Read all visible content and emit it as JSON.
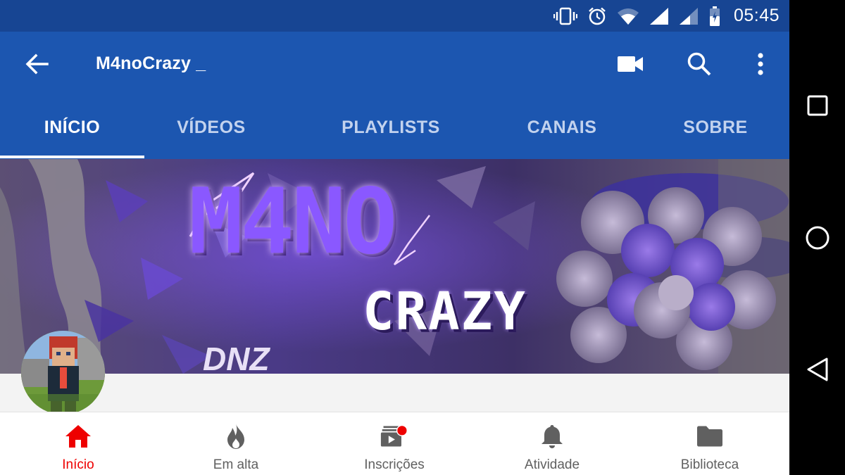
{
  "status_bar": {
    "time": "05:45"
  },
  "app_bar": {
    "title": "M4noCrazy _"
  },
  "tabs": [
    {
      "label": "INÍCIO",
      "active": true
    },
    {
      "label": "VÍDEOS",
      "active": false
    },
    {
      "label": "PLAYLISTS",
      "active": false
    },
    {
      "label": "CANAIS",
      "active": false
    },
    {
      "label": "SOBRE",
      "active": false
    }
  ],
  "banner": {
    "line1": "M4NO",
    "line2": "CRAZY",
    "signature": "DNZ"
  },
  "bottom_nav": [
    {
      "label": "Início",
      "icon": "home-icon",
      "active": true
    },
    {
      "label": "Em alta",
      "icon": "flame-icon",
      "active": false
    },
    {
      "label": "Inscrições",
      "icon": "subscriptions-icon",
      "active": false
    },
    {
      "label": "Atividade",
      "icon": "bell-icon",
      "active": false
    },
    {
      "label": "Biblioteca",
      "icon": "folder-icon",
      "active": false
    }
  ],
  "colors": {
    "status_bar": "#174593",
    "app_bar": "#1c56b0",
    "active_nav": "#ee0000",
    "inactive_tab": "#c2d2ee"
  }
}
